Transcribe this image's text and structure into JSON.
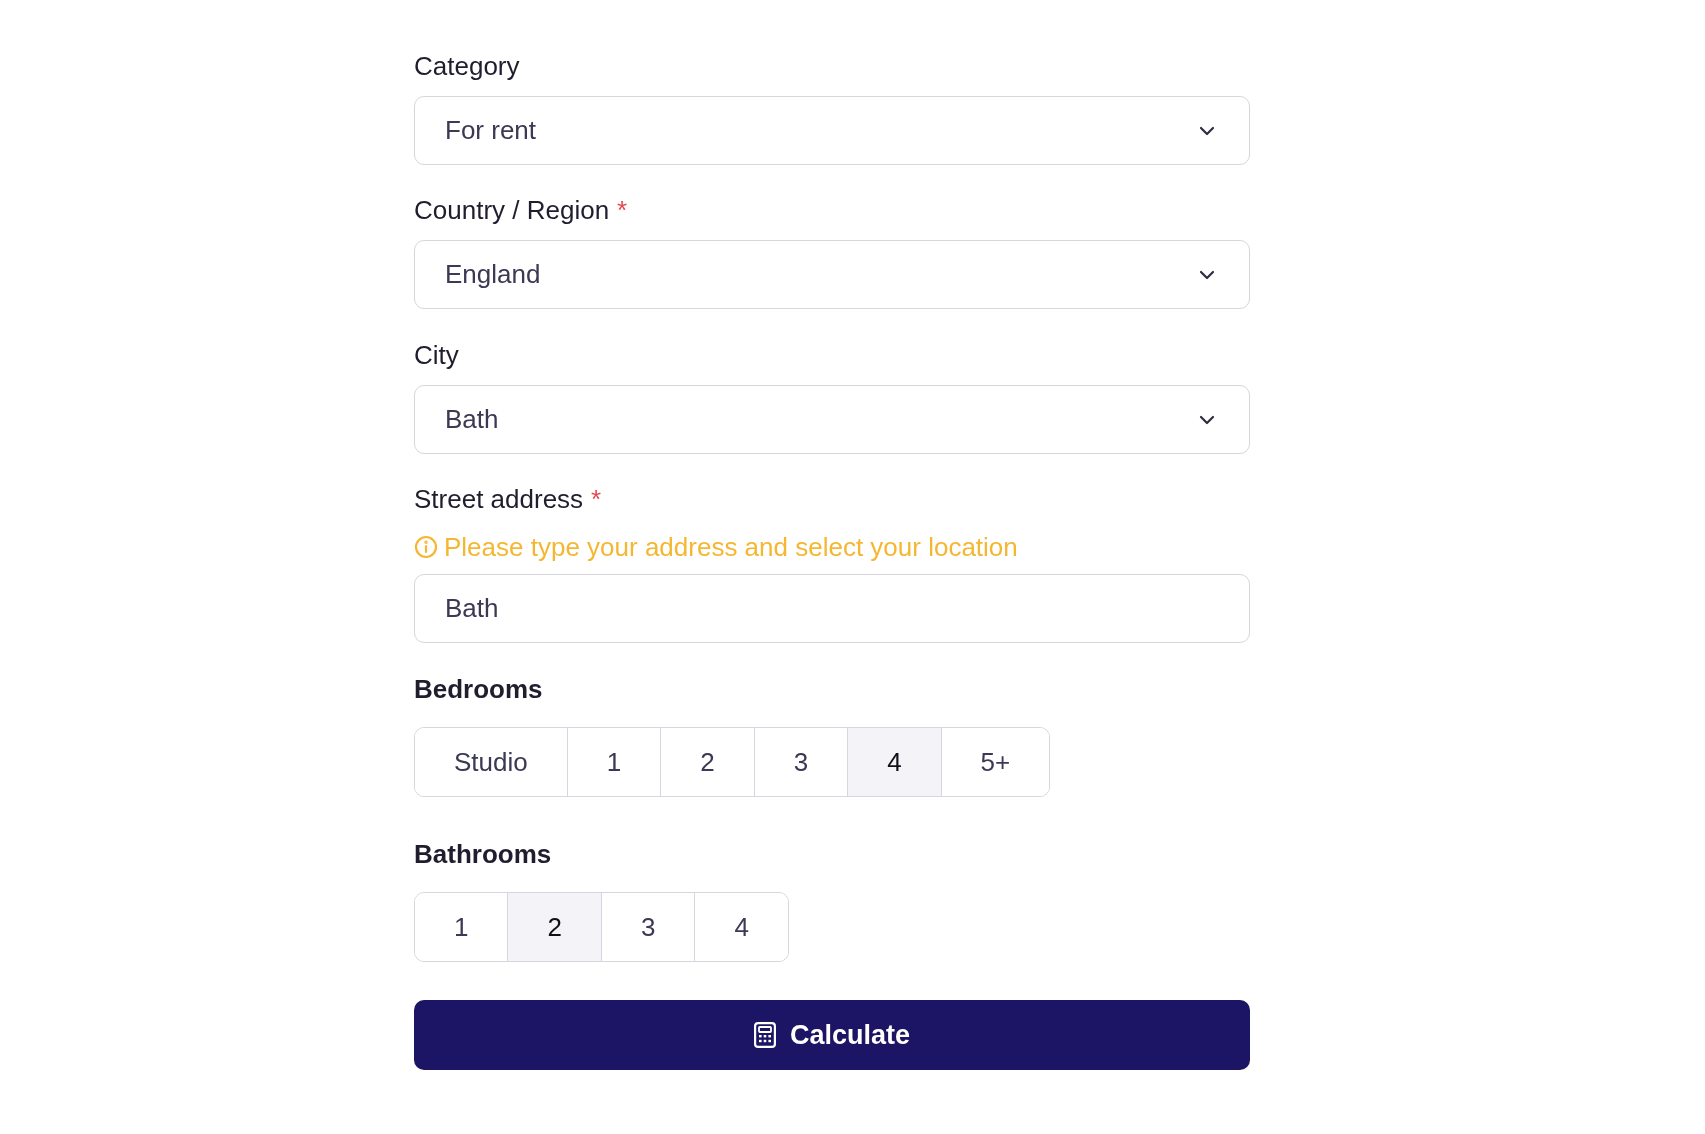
{
  "fields": [
    {
      "kind": "select",
      "label": "Category",
      "value": "For rent"
    },
    {
      "kind": "select",
      "label": "Country / Region",
      "required_mark": "*",
      "value": "England"
    },
    {
      "kind": "select",
      "label": "City",
      "value": "Bath"
    },
    {
      "kind": "text",
      "label": "Street address",
      "required_mark": "*",
      "hint": "Please type your address and select your location",
      "value": "Bath"
    }
  ],
  "bedrooms": {
    "label": "Bedrooms",
    "options": [
      {
        "label": "Studio",
        "selected": false
      },
      {
        "label": "1",
        "selected": false
      },
      {
        "label": "2",
        "selected": false
      },
      {
        "label": "3",
        "selected": false
      },
      {
        "label": "4",
        "selected": true
      },
      {
        "label": "5+",
        "selected": false
      }
    ]
  },
  "bathrooms": {
    "label": "Bathrooms",
    "options": [
      {
        "label": "1",
        "selected": false
      },
      {
        "label": "2",
        "selected": true
      },
      {
        "label": "3",
        "selected": false
      },
      {
        "label": "4",
        "selected": false
      }
    ]
  },
  "calculate_button": {
    "label": "Calculate"
  }
}
